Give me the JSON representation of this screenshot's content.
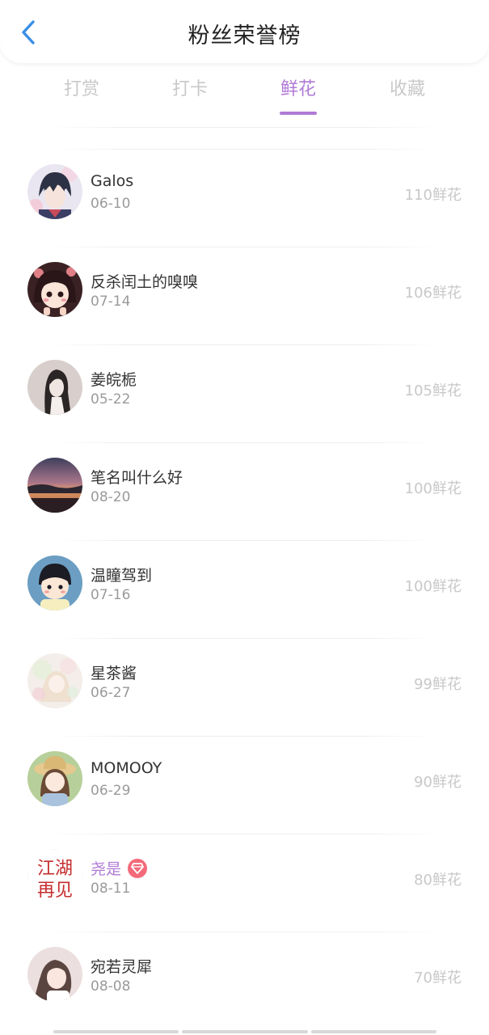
{
  "header": {
    "title": "粉丝荣誉榜"
  },
  "tabs": [
    {
      "label": "打赏",
      "active": false
    },
    {
      "label": "打卡",
      "active": false
    },
    {
      "label": "鲜花",
      "active": true
    },
    {
      "label": "收藏",
      "active": false
    }
  ],
  "colors": {
    "accent": "#b07ad6",
    "back_icon": "#3a8ee6",
    "badge": "#f36a7a",
    "amount_text": "#c8c8c8",
    "date_text": "#9a9a9a"
  },
  "fans": [
    {
      "name": "Galos",
      "date": "06-10",
      "amount": "110鲜花",
      "avatar": "anime-boy-avatar"
    },
    {
      "name": "反杀闰土的嗅嗅",
      "date": "07-14",
      "amount": "106鲜花",
      "avatar": "cartoon-girl-avatar"
    },
    {
      "name": "姜皖栀",
      "date": "05-22",
      "amount": "105鲜花",
      "avatar": "ink-girl-avatar"
    },
    {
      "name": "笔名叫什么好",
      "date": "08-20",
      "amount": "100鲜花",
      "avatar": "sunset-lake-avatar"
    },
    {
      "name": "温瞳驾到",
      "date": "07-16",
      "amount": "100鲜花",
      "avatar": "cartoon-kid-avatar"
    },
    {
      "name": "星茶酱",
      "date": "06-27",
      "amount": "99鲜花",
      "avatar": "pastel-girl-avatar"
    },
    {
      "name": "MOMOOY",
      "date": "06-29",
      "amount": "90鲜花",
      "avatar": "hat-girl-avatar"
    },
    {
      "name": "尧是",
      "date": "08-11",
      "amount": "80鲜花",
      "avatar": "calligraphy-avatar",
      "vip": true,
      "avatar_text": "江湖再见"
    },
    {
      "name": "宛若灵犀",
      "date": "08-08",
      "amount": "70鲜花",
      "avatar": "braid-girl-avatar"
    }
  ]
}
